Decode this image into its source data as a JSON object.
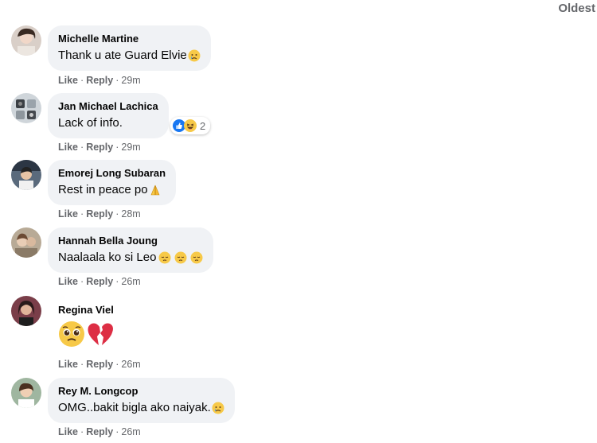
{
  "sort": {
    "label": "Oldest"
  },
  "comments": [
    {
      "author": "Michelle Martine",
      "text": "Thank u ate Guard Elvie",
      "emojis": [
        "cry-face-icon"
      ],
      "actions": {
        "like": "Like",
        "reply": "Reply",
        "time": "29m"
      }
    },
    {
      "author": "Jan Michael Lachica",
      "text": "Lack of info.",
      "emojis": [],
      "reactions": {
        "icons": [
          "like-reaction-icon",
          "haha-reaction-icon"
        ],
        "count": "2"
      },
      "actions": {
        "like": "Like",
        "reply": "Reply",
        "time": "29m"
      }
    },
    {
      "author": "Emorej Long Subaran",
      "text": "Rest in peace po",
      "emojis": [
        "folded-hands-icon"
      ],
      "actions": {
        "like": "Like",
        "reply": "Reply",
        "time": "28m"
      }
    },
    {
      "author": "Hannah Bella Joung",
      "text": "Naalaala ko si Leo",
      "emojis": [
        "pensive-face-icon",
        "pensive-face-icon",
        "pensive-face-icon"
      ],
      "actions": {
        "like": "Like",
        "reply": "Reply",
        "time": "26m"
      }
    },
    {
      "author": "Regina Viel",
      "text": "",
      "emojis": [
        "pleading-face-icon",
        "broken-heart-icon"
      ],
      "actions": {
        "like": "Like",
        "reply": "Reply",
        "time": "26m"
      }
    },
    {
      "author": "Rey M. Longcop",
      "text": "OMG..bakit bigla ako naiyak.",
      "emojis": [
        "cry-face-icon"
      ],
      "actions": {
        "like": "Like",
        "reply": "Reply",
        "time": "26m"
      }
    }
  ],
  "colors": {
    "bubble": "#f0f2f5",
    "secondary_text": "#65676b",
    "primary_text": "#050505",
    "like_blue": "#1877f2"
  }
}
